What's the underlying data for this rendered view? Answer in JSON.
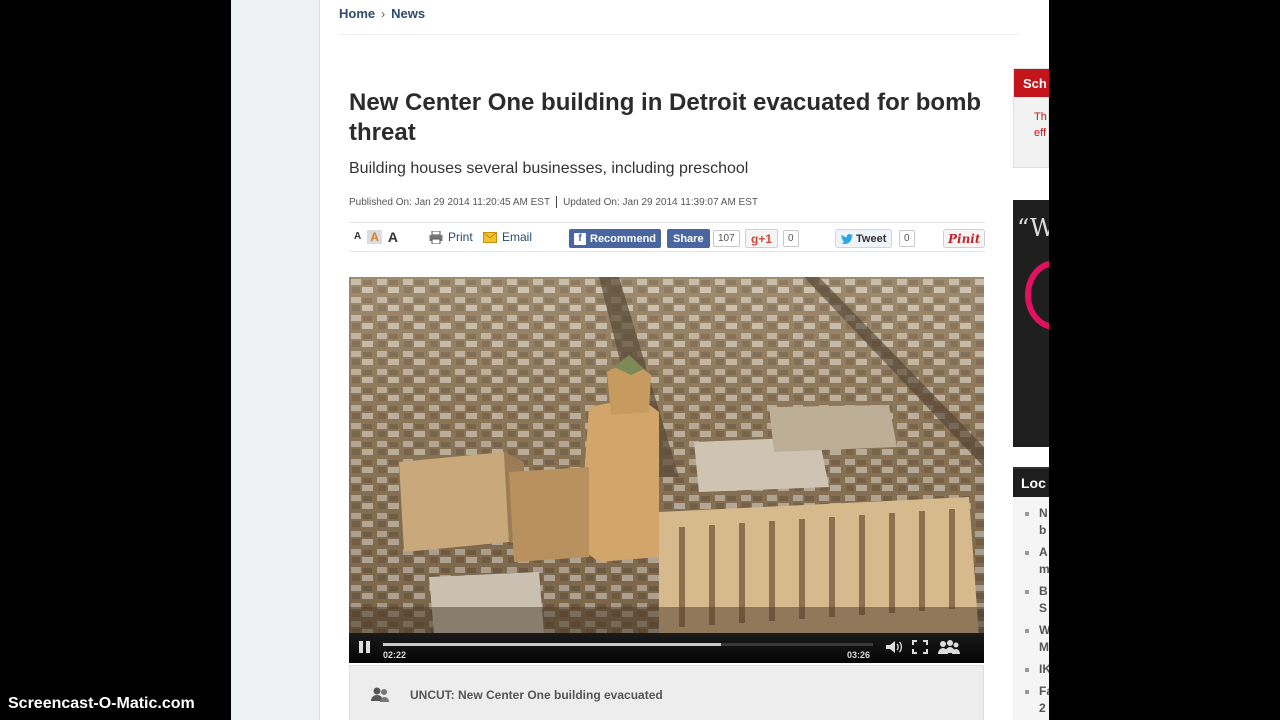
{
  "breadcrumb": {
    "home": "Home",
    "separator": "›",
    "current": "News"
  },
  "article": {
    "headline": "New Center One building in Detroit evacuated for bomb threat",
    "subhead": "Building houses several businesses, including preschool",
    "published": "Published On: Jan 29 2014 11:20:45 AM EST",
    "updated": "Updated On: Jan 29 2014 11:39:07 AM EST"
  },
  "toolbar": {
    "font_sizes": [
      "A",
      "A",
      "A"
    ],
    "print_label": "Print",
    "email_label": "Email",
    "fb_icon": "f",
    "recommend_label": "Recommend",
    "share_label": "Share",
    "share_count": "107",
    "gplus_label": "g+1",
    "gplus_count": "0",
    "tweet_label": "Tweet",
    "tweet_count": "0",
    "pinit_label": "Pinit",
    "icons": {
      "print": "printer-icon",
      "email": "envelope-icon",
      "twitter": "bird-icon"
    }
  },
  "video": {
    "elapsed": "02:22",
    "duration": "03:26",
    "progress_fraction": 0.69,
    "caption": "UNCUT: New Center One building evacuated"
  },
  "rail": {
    "box1_title": "Sch",
    "box1_text": [
      "Th",
      "eff"
    ],
    "ad_quote": "“W",
    "local_title": "Loc",
    "local_items": [
      [
        "N",
        "b"
      ],
      [
        "A",
        "m"
      ],
      [
        "B",
        "S"
      ],
      [
        "W",
        "M"
      ],
      [
        "IK",
        ""
      ],
      [
        "Fa",
        "2"
      ]
    ]
  },
  "colors": {
    "brand_red": "#c4151c",
    "facebook": "#4a66a0",
    "link": "#2e4a6a"
  },
  "watermark": "Screencast-O-Matic.com"
}
